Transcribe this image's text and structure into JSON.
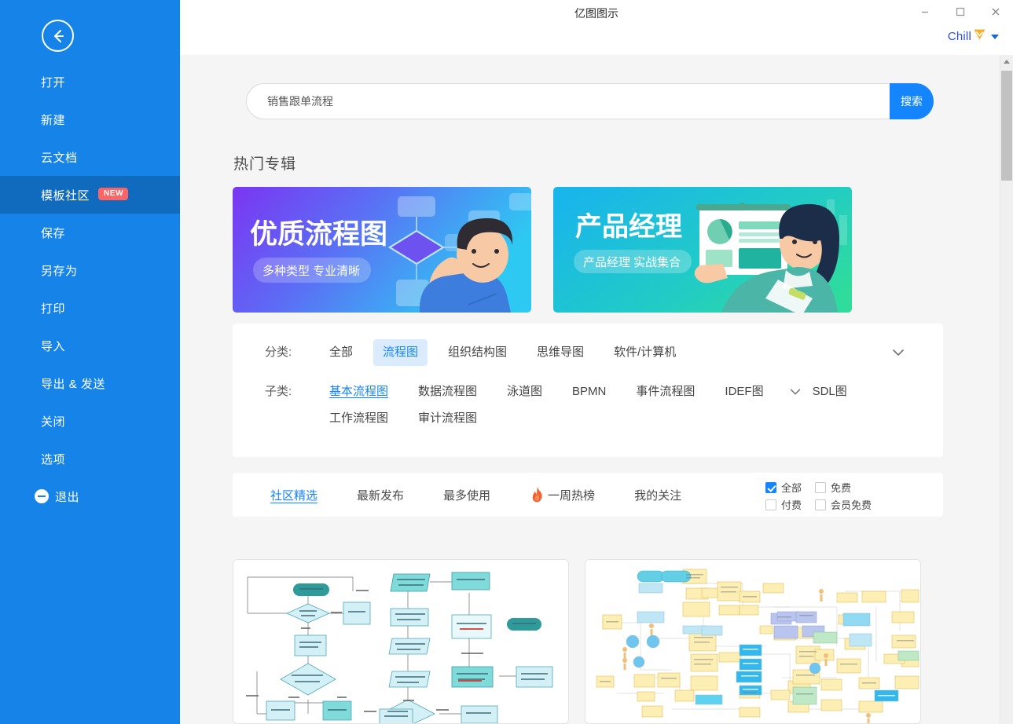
{
  "window": {
    "title": "亿图图示",
    "minimize_label": "−",
    "maximize_label": "□",
    "close_label": "✕"
  },
  "user": {
    "name": "Chill",
    "vip_badge": "vip-diamond-icon",
    "caret": "chevron-down-icon"
  },
  "sidebar": {
    "back_icon": "back-arrow-icon",
    "items": [
      {
        "label": "打开",
        "active": false
      },
      {
        "label": "新建",
        "active": false
      },
      {
        "label": "云文档",
        "active": false
      },
      {
        "label": "模板社区",
        "active": true,
        "badge": "NEW"
      },
      {
        "label": "保存",
        "active": false
      },
      {
        "label": "另存为",
        "active": false
      },
      {
        "label": "打印",
        "active": false
      },
      {
        "label": "导入",
        "active": false
      },
      {
        "label": "导出 & 发送",
        "active": false
      },
      {
        "label": "关闭",
        "active": false
      },
      {
        "label": "选项",
        "active": false
      },
      {
        "label": "退出",
        "active": false,
        "icon": "exit-icon"
      }
    ]
  },
  "search": {
    "value": "销售跟单流程",
    "placeholder": "销售跟单流程",
    "button_label": "搜索"
  },
  "hot_section": {
    "title": "热门专辑",
    "banners": [
      {
        "title": "优质流程图",
        "subtitle": "多种类型 专业清晰",
        "color_start": "#6d3ef0",
        "color_end": "#2fc2f0"
      },
      {
        "title": "产品经理",
        "subtitle": "产品经理 实战集合",
        "color_start": "#16b8e8",
        "color_end": "#2ad9a6"
      }
    ]
  },
  "category_panel": {
    "rows": [
      {
        "label": "分类:",
        "items": [
          {
            "label": "全部",
            "state": "normal"
          },
          {
            "label": "流程图",
            "state": "selected-bg"
          },
          {
            "label": "组织结构图",
            "state": "normal"
          },
          {
            "label": "思维导图",
            "state": "normal"
          },
          {
            "label": "软件/计算机",
            "state": "normal"
          }
        ],
        "expand_icon": "chevron-down-icon"
      },
      {
        "label": "子类:",
        "items": [
          {
            "label": "基本流程图",
            "state": "selected-underline"
          },
          {
            "label": "数据流程图",
            "state": "normal"
          },
          {
            "label": "泳道图",
            "state": "normal"
          },
          {
            "label": "BPMN",
            "state": "normal"
          },
          {
            "label": "事件流程图",
            "state": "normal"
          },
          {
            "label": "IDEF图",
            "state": "normal"
          },
          {
            "label": "SDL图",
            "state": "normal"
          },
          {
            "label": "工作流程图",
            "state": "normal"
          },
          {
            "label": "审计流程图",
            "state": "normal"
          }
        ],
        "expand_icon": "chevron-down-icon"
      }
    ]
  },
  "filter_bar": {
    "tabs": [
      {
        "label": "社区精选",
        "active": true,
        "icon": ""
      },
      {
        "label": "最新发布",
        "active": false,
        "icon": ""
      },
      {
        "label": "最多使用",
        "active": false,
        "icon": ""
      },
      {
        "label": "一周热榜",
        "active": false,
        "icon": "fire-icon"
      },
      {
        "label": "我的关注",
        "active": false,
        "icon": ""
      }
    ],
    "checkboxes": [
      {
        "label": "全部",
        "checked": true
      },
      {
        "label": "免费",
        "checked": false
      },
      {
        "label": "付费",
        "checked": false
      },
      {
        "label": "会员免费",
        "checked": false
      }
    ]
  },
  "templates": {
    "cards": [
      {
        "name": "ui-design-review-flowchart-thumbnail"
      },
      {
        "name": "large-business-process-map-thumbnail"
      }
    ]
  },
  "colors": {
    "sidebar_bg": "#1583e8",
    "sidebar_active": "#106bbe",
    "accent_blue": "#1585ff",
    "content_bg": "#f5f5f5",
    "panel_white": "#ffffff",
    "badge_red": "#fc6566",
    "chip_selected_bg": "#d9ebfd"
  }
}
